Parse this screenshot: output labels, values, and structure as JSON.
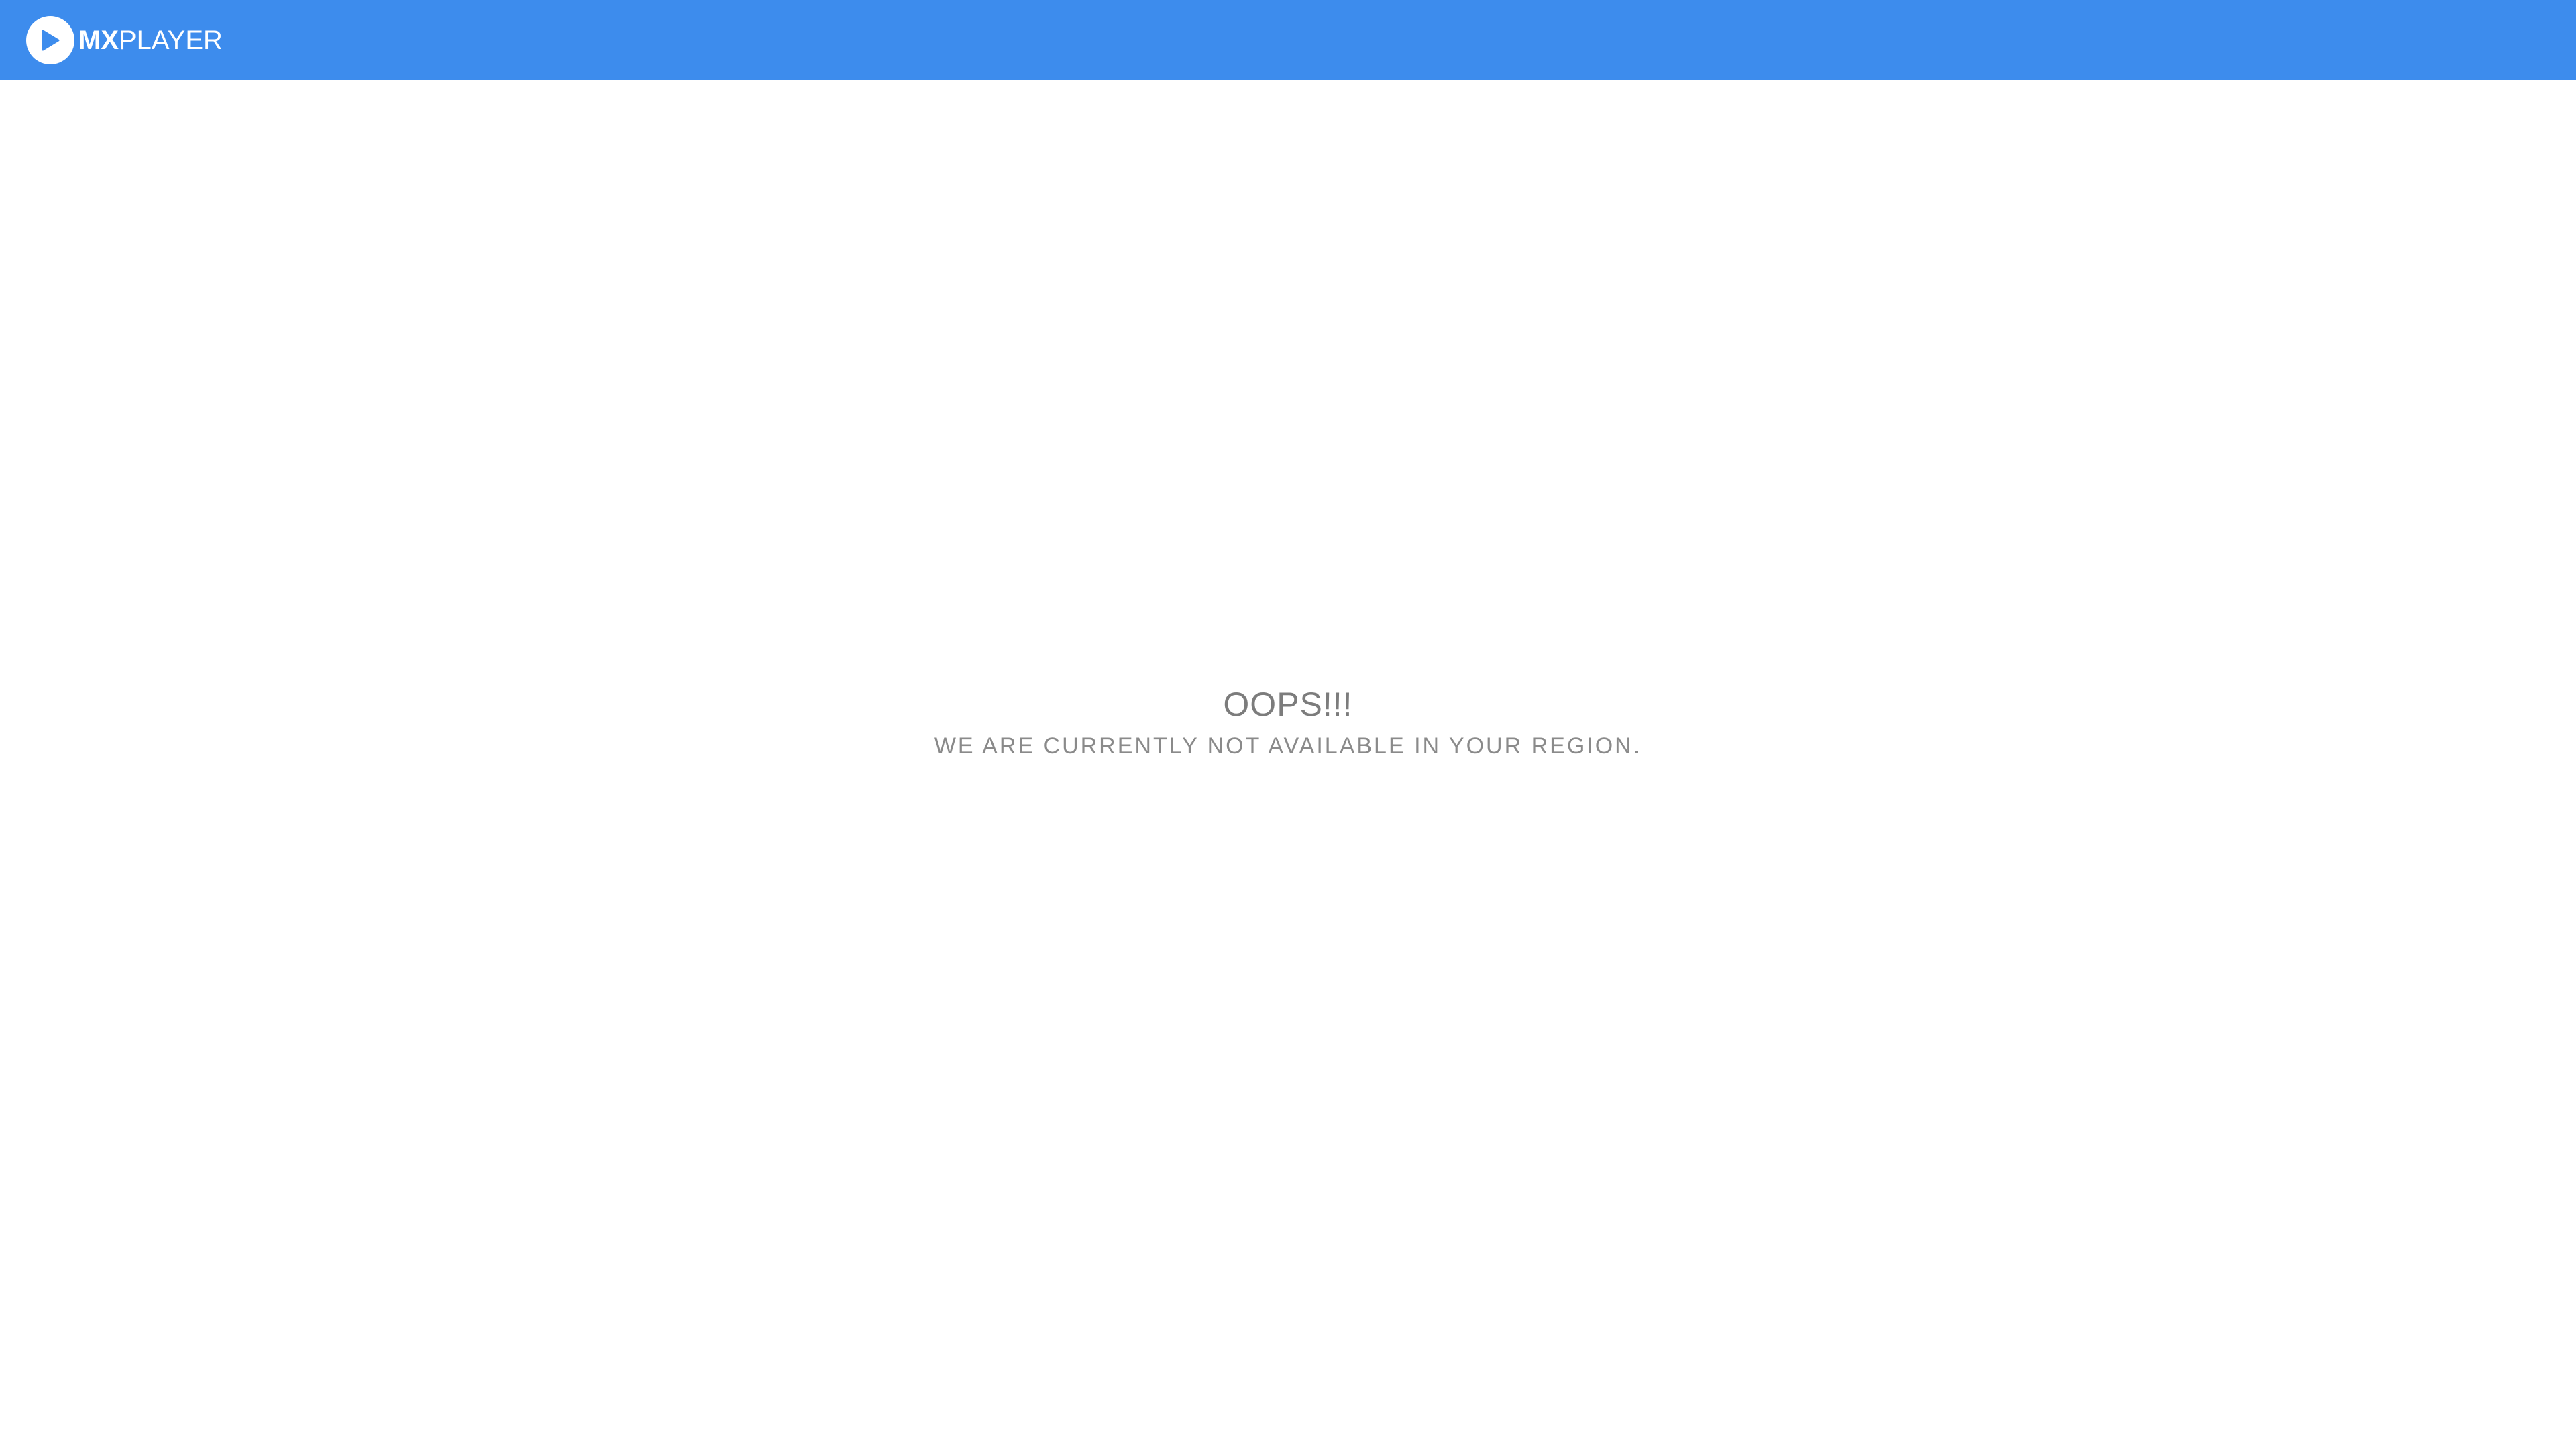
{
  "header": {
    "brand": {
      "mx": "MX",
      "player": "PLAYER",
      "icon": "play-icon"
    }
  },
  "main": {
    "title": "OOPS!!!",
    "message": "WE ARE CURRENTLY NOT AVAILABLE IN YOUR REGION."
  },
  "colors": {
    "header_bg": "#3d8ced",
    "text": "#7c7c7c",
    "logo": "#ffffff"
  }
}
